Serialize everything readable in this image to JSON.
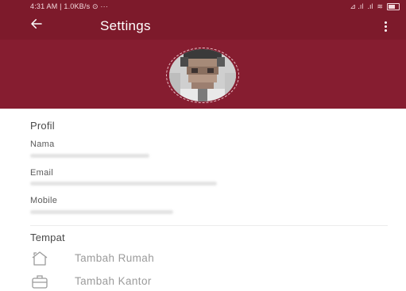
{
  "status_bar": {
    "left_text": "4:31 AM | 1.0KB/s ⊙  ···",
    "signal_text": "⊿ .ıl",
    "signal2_text": ".ıl",
    "wifi_text": "≋"
  },
  "app_bar": {
    "title": "Settings"
  },
  "profile": {
    "section_title": "Profil",
    "name_label": "Nama",
    "email_label": "Email",
    "mobile_label": "Mobile"
  },
  "places": {
    "section_title": "Tempat",
    "items": [
      {
        "label": "Tambah Rumah",
        "icon": "home-icon"
      },
      {
        "label": "Tambah Kantor",
        "icon": "briefcase-icon"
      }
    ]
  },
  "colors": {
    "primary": "#7d1a2b",
    "banner": "#861d30"
  }
}
